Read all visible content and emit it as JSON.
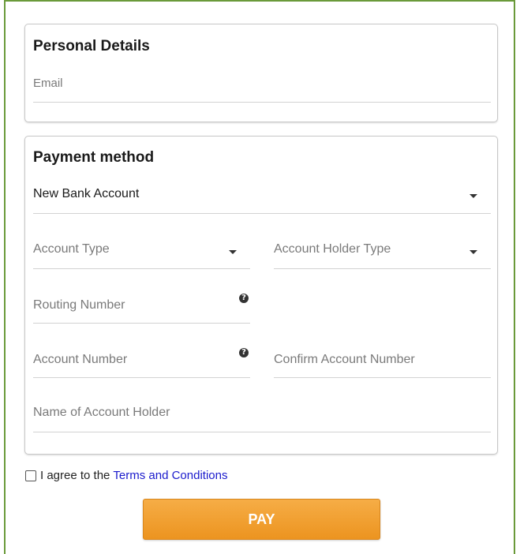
{
  "personal": {
    "title": "Personal Details",
    "email_placeholder": "Email"
  },
  "payment": {
    "title": "Payment method",
    "method_value": "New Bank Account",
    "account_type_placeholder": "Account Type",
    "account_holder_type_placeholder": "Account Holder Type",
    "routing_number_placeholder": "Routing Number",
    "account_number_placeholder": "Account Number",
    "confirm_account_number_placeholder": "Confirm Account Number",
    "account_holder_name_placeholder": "Name of Account Holder"
  },
  "agreement": {
    "text": "I agree to the",
    "link": "Terms and Conditions"
  },
  "pay_button_label": "PAY",
  "colors": {
    "frame_border": "#6a9a3a",
    "pay_button": "#f0a030",
    "link": "#1a1acc"
  },
  "icons": {
    "dropdown": "chevron-down-icon",
    "help": "question-circle-icon"
  }
}
